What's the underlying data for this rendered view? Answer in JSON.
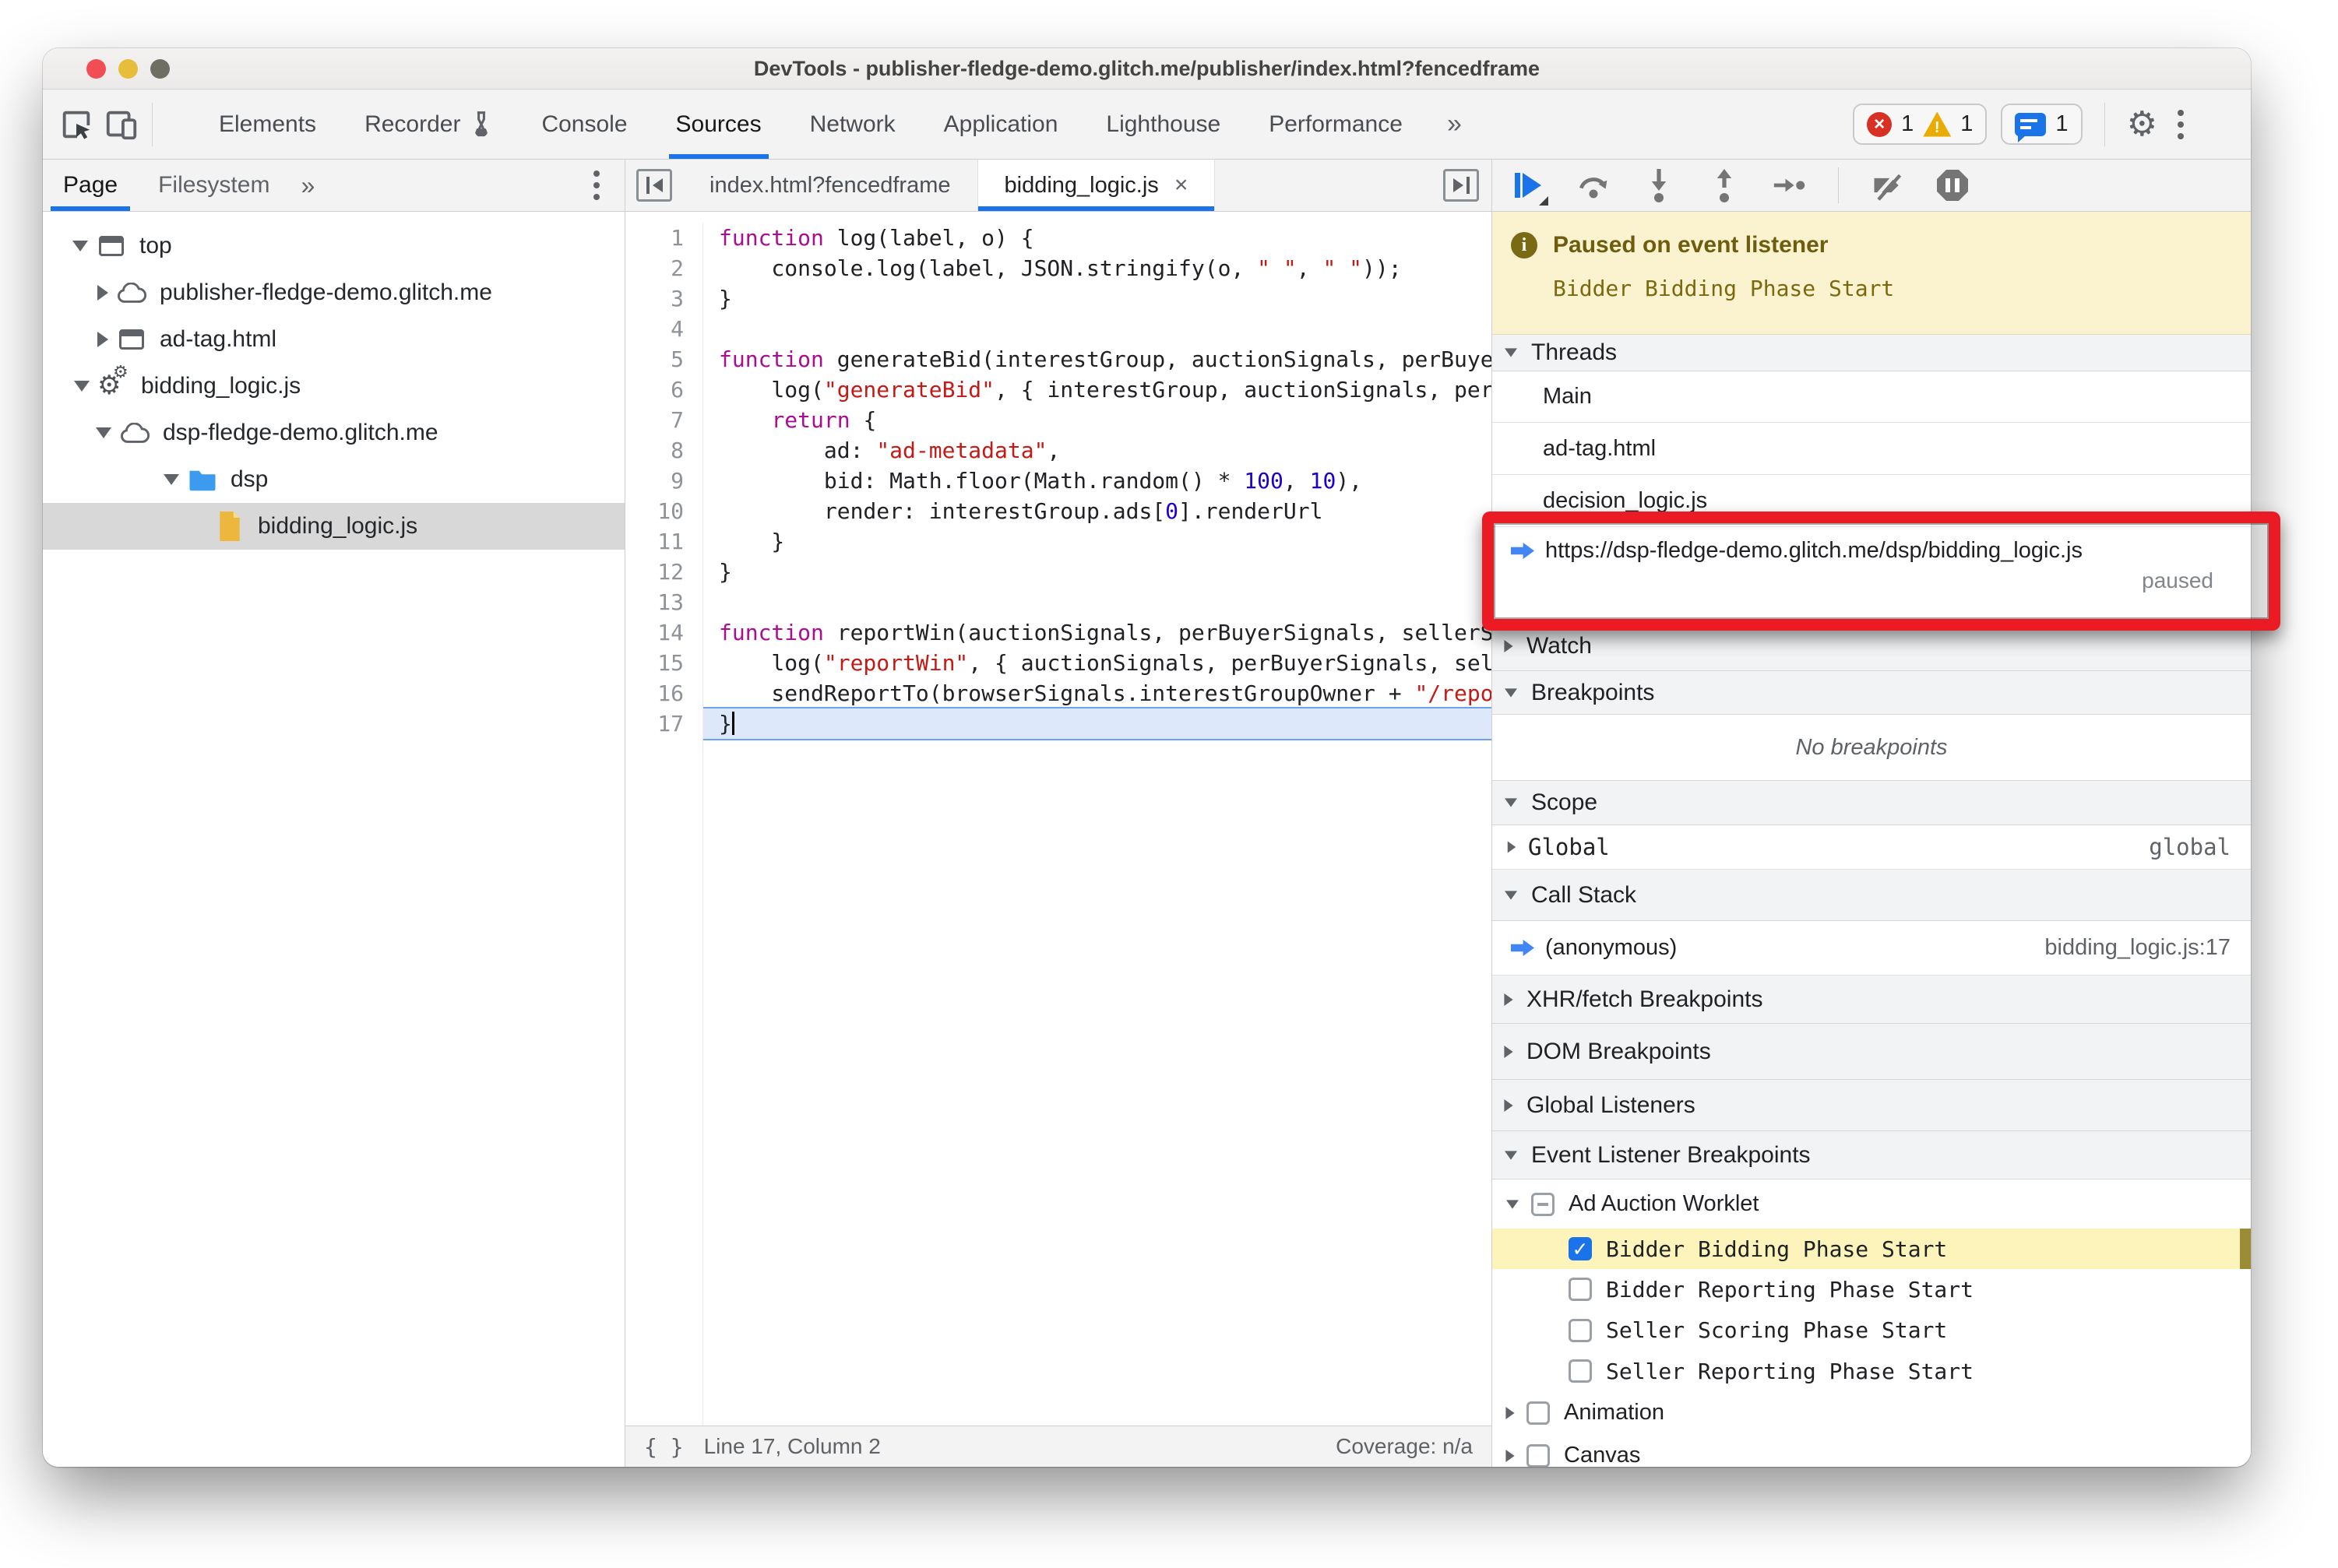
{
  "window": {
    "title": "DevTools - publisher-fledge-demo.glitch.me/publisher/index.html?fencedframe"
  },
  "toolbar": {
    "tabs": [
      {
        "label": "Elements"
      },
      {
        "label": "Recorder"
      },
      {
        "label": "Console"
      },
      {
        "label": "Sources"
      },
      {
        "label": "Network"
      },
      {
        "label": "Application"
      },
      {
        "label": "Lighthouse"
      },
      {
        "label": "Performance"
      }
    ],
    "selected_tab": "Sources",
    "more_chevron": "»",
    "error_count": "1",
    "warning_count": "1",
    "message_count": "1"
  },
  "sidebar": {
    "tabs": [
      {
        "label": "Page"
      },
      {
        "label": "Filesystem"
      }
    ],
    "more_chevron": "»",
    "tree": [
      {
        "label": "top"
      },
      {
        "label": "publisher-fledge-demo.glitch.me"
      },
      {
        "label": "ad-tag.html"
      },
      {
        "label": "bidding_logic.js"
      },
      {
        "label": "dsp-fledge-demo.glitch.me"
      },
      {
        "label": "dsp"
      },
      {
        "label": "bidding_logic.js"
      }
    ]
  },
  "editor": {
    "tabs": [
      {
        "label": "index.html?fencedframe"
      },
      {
        "label": "bidding_logic.js",
        "close": "×"
      }
    ],
    "lines": [
      {
        "n": "1",
        "t": [
          [
            "k",
            "function"
          ],
          [
            "p",
            " log(label, o) {"
          ]
        ]
      },
      {
        "n": "2",
        "t": [
          [
            "p",
            "    console.log(label, JSON.stringify(o, "
          ],
          [
            "s",
            "\" \""
          ],
          [
            "p",
            ", "
          ],
          [
            "s",
            "\" \""
          ],
          [
            "p",
            "));"
          ]
        ]
      },
      {
        "n": "3",
        "t": [
          [
            "p",
            "}"
          ]
        ]
      },
      {
        "n": "4",
        "t": []
      },
      {
        "n": "5",
        "t": [
          [
            "k",
            "function"
          ],
          [
            "p",
            " generateBid(interestGroup, auctionSignals, perBuyerSignals, trustedBiddingSignals) {"
          ]
        ]
      },
      {
        "n": "6",
        "t": [
          [
            "p",
            "    log("
          ],
          [
            "s",
            "\"generateBid\""
          ],
          [
            "p",
            ", { interestGroup, auctionSignals, perBuyerSignals });"
          ]
        ]
      },
      {
        "n": "7",
        "t": [
          [
            "p",
            "    "
          ],
          [
            "k",
            "return"
          ],
          [
            "p",
            " {"
          ]
        ]
      },
      {
        "n": "8",
        "t": [
          [
            "p",
            "        ad: "
          ],
          [
            "s",
            "\"ad-metadata\""
          ],
          [
            "p",
            ","
          ]
        ]
      },
      {
        "n": "9",
        "t": [
          [
            "p",
            "        bid: Math.floor(Math.random() * "
          ],
          [
            "num",
            "100"
          ],
          [
            "p",
            ", "
          ],
          [
            "num",
            "10"
          ],
          [
            "p",
            "),"
          ]
        ]
      },
      {
        "n": "10",
        "t": [
          [
            "p",
            "        render: interestGroup.ads["
          ],
          [
            "num",
            "0"
          ],
          [
            "p",
            "].renderUrl"
          ]
        ]
      },
      {
        "n": "11",
        "t": [
          [
            "p",
            "    }"
          ]
        ]
      },
      {
        "n": "12",
        "t": [
          [
            "p",
            "}"
          ]
        ]
      },
      {
        "n": "13",
        "t": []
      },
      {
        "n": "14",
        "t": [
          [
            "k",
            "function"
          ],
          [
            "p",
            " reportWin(auctionSignals, perBuyerSignals, sellerSignals, browserSignals) {"
          ]
        ]
      },
      {
        "n": "15",
        "t": [
          [
            "p",
            "    log("
          ],
          [
            "s",
            "\"reportWin\""
          ],
          [
            "p",
            ", { auctionSignals, perBuyerSignals, sellerSignals });"
          ]
        ]
      },
      {
        "n": "16",
        "t": [
          [
            "p",
            "    sendReportTo(browserSignals.interestGroupOwner + "
          ],
          [
            "s",
            "\"/report\""
          ],
          [
            "p",
            ");"
          ]
        ]
      },
      {
        "n": "17",
        "t": [
          [
            "p",
            "}"
          ]
        ],
        "current": true
      }
    ],
    "status": {
      "position": "Line 17, Column 2",
      "coverage": "Coverage: n/a"
    }
  },
  "debugger": {
    "banner": {
      "title": "Paused on event listener",
      "subtitle": "Bidder Bidding Phase Start"
    },
    "threads": {
      "header": "Threads",
      "items": [
        {
          "label": "Main"
        },
        {
          "label": "ad-tag.html"
        },
        {
          "label": "decision_logic.js"
        }
      ],
      "paused_thread": {
        "url": "https://dsp-fledge-demo.glitch.me/dsp/bidding_logic.js",
        "status": "paused"
      }
    },
    "watch_header": "Watch",
    "breakpoints": {
      "header": "Breakpoints",
      "empty": "No breakpoints"
    },
    "scope": {
      "header": "Scope",
      "item": "Global",
      "value": "global"
    },
    "call_stack": {
      "header": "Call Stack",
      "frame": "(anonymous)",
      "location": "bidding_logic.js:17"
    },
    "xhr_header": "XHR/fetch Breakpoints",
    "dom_header": "DOM Breakpoints",
    "global_listeners_header": "Global Listeners",
    "event_listener_breakpoints": {
      "header": "Event Listener Breakpoints",
      "group": "Ad Auction Worklet",
      "items": [
        {
          "label": "Bidder Bidding Phase Start",
          "checked": true
        },
        {
          "label": "Bidder Reporting Phase Start",
          "checked": false
        },
        {
          "label": "Seller Scoring Phase Start",
          "checked": false
        },
        {
          "label": "Seller Reporting Phase Start",
          "checked": false
        }
      ],
      "extra_groups": [
        {
          "label": "Animation"
        },
        {
          "label": "Canvas"
        }
      ]
    }
  }
}
